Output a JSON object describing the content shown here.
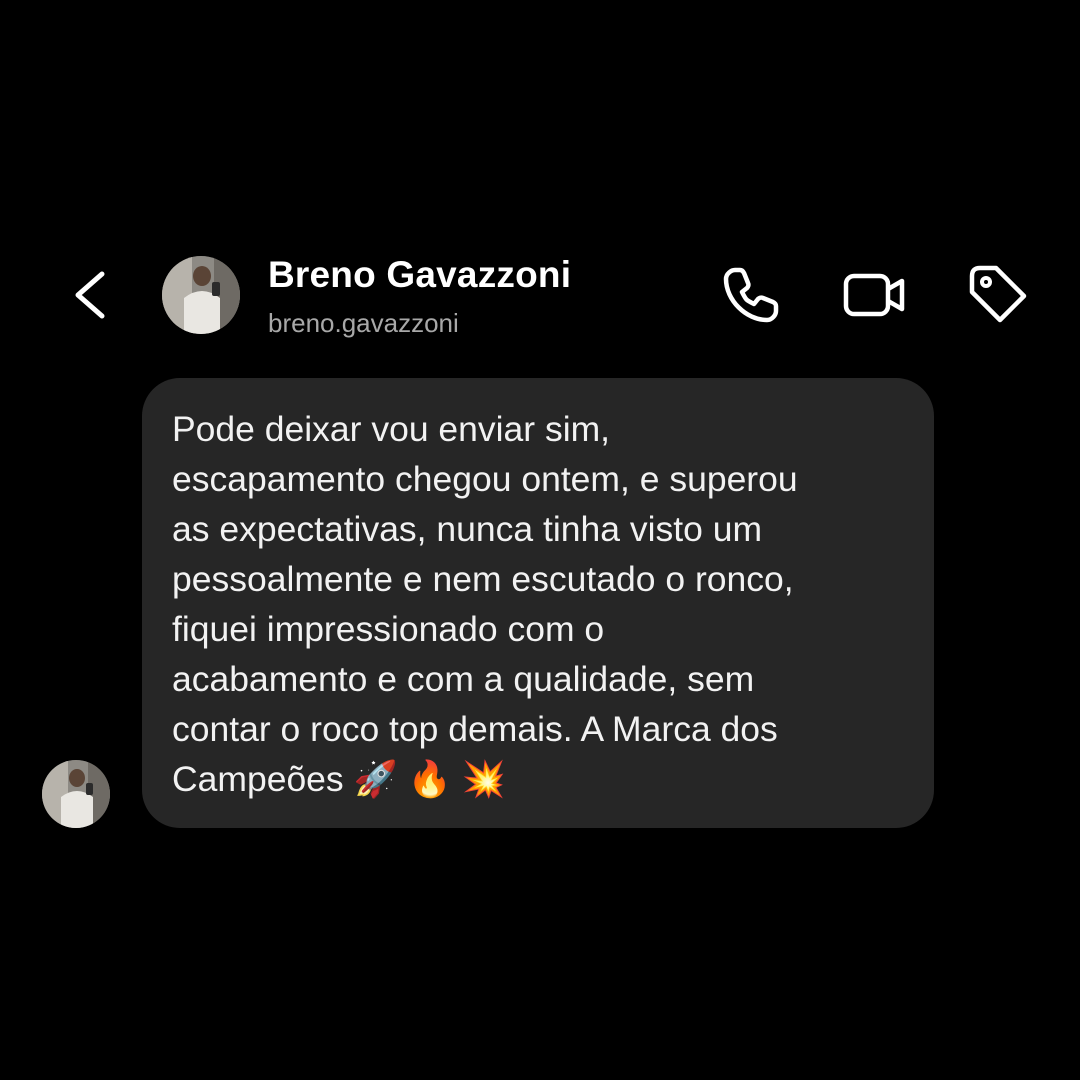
{
  "header": {
    "contact_name": "Breno Gavazzoni",
    "contact_username": "breno.gavazzoni",
    "icons": [
      "chevron-left-icon",
      "phone-icon",
      "video-camera-icon",
      "tag-icon"
    ]
  },
  "messages": [
    {
      "sender": "Breno Gavazzoni",
      "text": "Pode deixar vou enviar sim,\nescapamento chegou ontem, e superou\nas expectativas, nunca tinha visto um\npessoalmente e nem escutado o ronco,\nfiquei impressionado com o\nacabamento e com a qualidade, sem\ncontar o roco top demais. A Marca dos\nCampeões 🚀 🔥 💥"
    }
  ],
  "colors": {
    "background": "#000000",
    "bubble": "#262626",
    "text": "#ffffff",
    "secondary_text": "#a8a8a8"
  }
}
